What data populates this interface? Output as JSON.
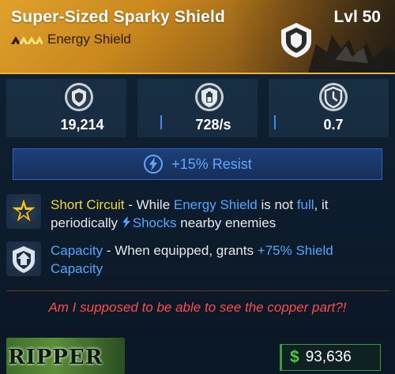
{
  "item": {
    "name": "Super-Sized Sparky Shield",
    "level": "Lvl 50",
    "type": "Energy Shield",
    "rarity_color": "#e0a12c"
  },
  "stats": [
    {
      "icon": "shield-capacity-icon",
      "value": "19,214"
    },
    {
      "icon": "shield-recharge-rate-icon",
      "value": "728/s"
    },
    {
      "icon": "shield-recharge-delay-icon",
      "value": "0.7"
    }
  ],
  "resist": {
    "icon": "shock-icon",
    "label": "+15% Resist",
    "color": "#5fa7ff"
  },
  "perks": [
    {
      "icon": "short-circuit-star-icon",
      "name": "Short Circuit",
      "t1": " - While ",
      "kw1": "Energy Shield",
      "t2": " is not ",
      "kw2": "full",
      "t3": ", it periodically ",
      "kw3": "Shocks",
      "t4": " nearby enemies"
    },
    {
      "icon": "capacity-arrow-icon",
      "name": "Capacity",
      "t1": " - When equipped, grants ",
      "kw1": "+75% Shield Capacity"
    }
  ],
  "note": "Am I supposed to be able to see the copper part?!",
  "footer": {
    "logo": "RIPPER",
    "price_icon": "dollar-icon",
    "price_symbol": "$",
    "price": "93,636"
  }
}
